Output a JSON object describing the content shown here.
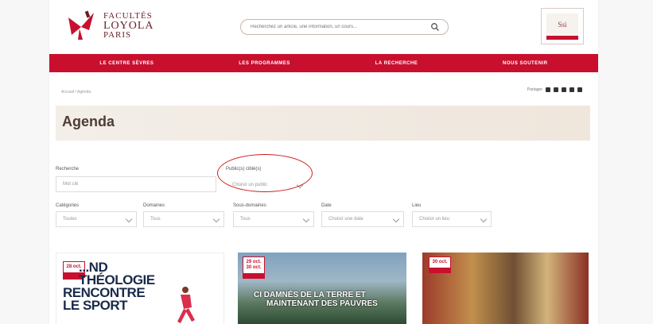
{
  "brand": {
    "line1": "FACULTÉS",
    "line2": "LOYOLA",
    "line3": "PARIS"
  },
  "search": {
    "placeholder": "Recherchez un article, une information, un cours..."
  },
  "badge": {
    "text": "Ssi"
  },
  "nav": {
    "items": [
      "Le Centre Sèvres",
      "Les Programmes",
      "La Recherche",
      "Nous Soutenir"
    ]
  },
  "breadcrumb": "Accueil / Agenda",
  "share": {
    "label": "Partager"
  },
  "page_title": "Agenda",
  "filters": {
    "recherche": {
      "label": "Recherche",
      "placeholder": "Mot clé"
    },
    "public": {
      "label": "Public(s) ciblé(s)",
      "value": "Choisir un public"
    },
    "categories": {
      "label": "Catégories",
      "value": "Toutes"
    },
    "domaines": {
      "label": "Domaines",
      "value": "Tous"
    },
    "sous_domaines": {
      "label": "Sous-domaines",
      "value": "Tous"
    },
    "date": {
      "label": "Date",
      "value": "Choisir une date"
    },
    "lieu": {
      "label": "Lieu",
      "value": "Choisir un lieu"
    }
  },
  "cards": [
    {
      "date": "28 oct.",
      "title_lines": [
        "...ND",
        "THÉOLOGIE",
        "RENCONTRE",
        "LE SPORT"
      ]
    },
    {
      "date": "29 oct. 30 oct.",
      "title_lines": [
        "CI DAMNÉS DE LA TERRE ET",
        "MAINTENANT DES PAUVRES"
      ]
    },
    {
      "date": "30 oct.",
      "title_lines": []
    }
  ],
  "colors": {
    "brand_red": "#c8102e",
    "title_color": "#4d3d35",
    "annotation": "#cc1f1f"
  }
}
